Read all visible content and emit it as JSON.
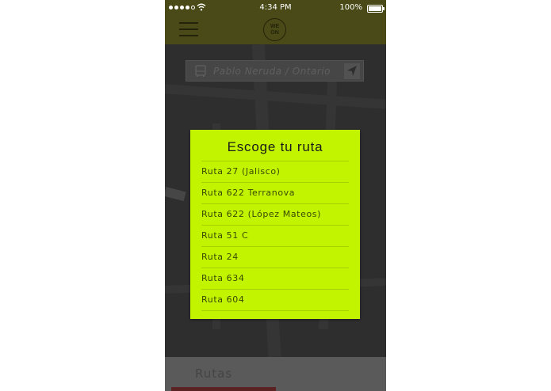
{
  "status_bar": {
    "time": "4:34 PM",
    "battery": "100%"
  },
  "header": {
    "menu_icon": "hamburger-icon",
    "logo_line1": "WE",
    "logo_line2": "ON"
  },
  "search": {
    "value": "Pablo Neruda / Ontario",
    "bus_icon": "bus-icon",
    "locate_icon": "location-arrow-icon"
  },
  "modal": {
    "title": "Escoge tu ruta",
    "routes": [
      "Ruta 27 (Jalisco)",
      "Ruta 622 Terranova",
      "Ruta 622 (López Mateos)",
      "Ruta 51 C",
      "Ruta 24",
      "Ruta 634",
      "Ruta 604"
    ]
  },
  "bottom": {
    "title": "Rutas"
  },
  "colors": {
    "header": "#4a4a18",
    "modal": "#c2f400",
    "map": "#3b3b3b"
  }
}
